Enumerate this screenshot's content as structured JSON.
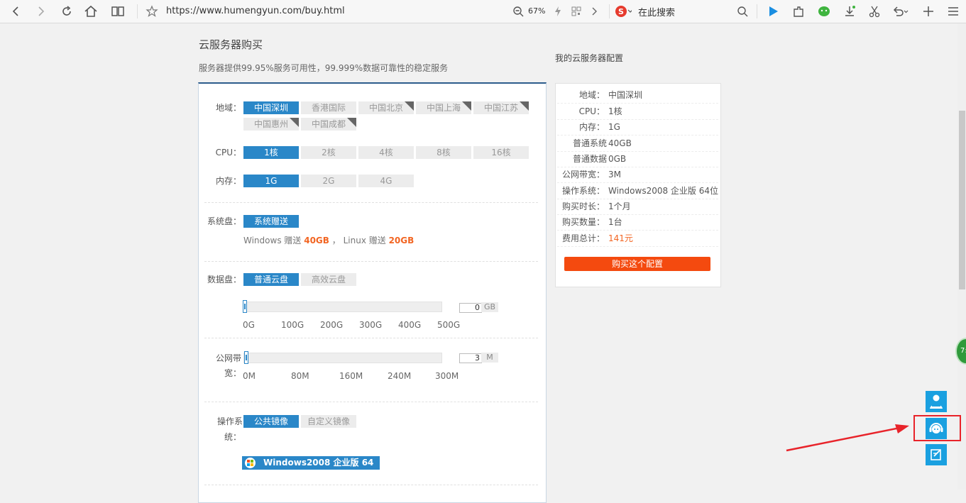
{
  "browser": {
    "url": "https://www.humengyun.com/buy.html",
    "zoom": "67%",
    "search_placeholder": "在此搜索"
  },
  "page": {
    "title": "云服务器购买",
    "subtitle": "服务器提供99.95%服务可用性，99.999%数据可靠性的稳定服务"
  },
  "form": {
    "region": {
      "label": "地域：",
      "options": [
        "中国深圳",
        "香港国际",
        "中国北京",
        "中国上海",
        "中国江苏",
        "中国惠州",
        "中国成都"
      ],
      "selected": "中国深圳"
    },
    "cpu": {
      "label": "CPU：",
      "options": [
        "1核",
        "2核",
        "4核",
        "8核",
        "16核"
      ],
      "selected": "1核"
    },
    "memory": {
      "label": "内存：",
      "options": [
        "1G",
        "2G",
        "4G"
      ],
      "selected": "1G"
    },
    "system_disk": {
      "label": "系统盘：",
      "option": "系统赠送",
      "note_prefix": "Windows 赠送",
      "note_win": "40GB",
      "note_sep": "，",
      "note_linux_prefix": "Linux 赠送",
      "note_linux": "20GB"
    },
    "data_disk": {
      "label": "数据盘：",
      "options": [
        "普通云盘",
        "高效云盘"
      ],
      "selected": "普通云盘",
      "value": "0",
      "unit": "GB",
      "ticks": [
        "0G",
        "100G",
        "200G",
        "300G",
        "400G",
        "500G"
      ]
    },
    "bandwidth": {
      "label_line1": "公网带",
      "label_line2": "宽：",
      "value": "3",
      "unit": "M",
      "ticks": [
        "0M",
        "80M",
        "160M",
        "240M",
        "300M"
      ]
    },
    "os": {
      "label_line1": "操作系",
      "label_line2": "统：",
      "options": [
        "公共镜像",
        "自定义镜像"
      ],
      "selected": "公共镜像",
      "image": "Windows2008 企业版 64位"
    }
  },
  "summary": {
    "title": "我的云服务器配置",
    "rows": [
      {
        "k": "地域：",
        "v": "中国深圳"
      },
      {
        "k": "CPU：",
        "v": "1核"
      },
      {
        "k": "内存：",
        "v": "1G"
      },
      {
        "k": "普通系统",
        "v": "40GB"
      },
      {
        "k": "普通数据",
        "v": "0GB"
      },
      {
        "k": "公网带宽：",
        "v": "3M"
      },
      {
        "k": "操作系统：",
        "v": "Windows2008 企业版 64位"
      },
      {
        "k": "购买时长：",
        "v": "1个月"
      },
      {
        "k": "购买数量：",
        "v": "1台"
      },
      {
        "k": "费用总计：",
        "v": "141元"
      }
    ],
    "buy_label": "购买这个配置"
  },
  "badge": {
    "text": "7:"
  },
  "icons": {
    "service": "customer-service-icon",
    "support": "headset-icon",
    "feedback": "edit-icon"
  },
  "colors": {
    "accent": "#2a87c8",
    "buy": "#f44a0f",
    "price": "#f26522",
    "highlight": "#e8232a"
  }
}
